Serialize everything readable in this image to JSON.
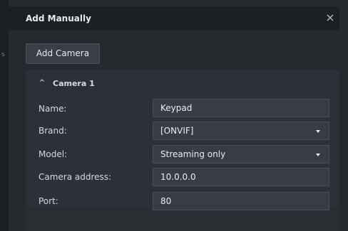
{
  "dialog": {
    "title": "Add Manually",
    "close_symbol": "×"
  },
  "toolbar": {
    "add_camera_label": "Add Camera"
  },
  "camera": {
    "section_label": "Camera 1",
    "toggle_icon": "chevron-up-icon",
    "toggle_symbol": "^",
    "fields": {
      "name": {
        "label": "Name:",
        "value": "Keypad"
      },
      "brand": {
        "label": "Brand:",
        "value": "[ONVIF]"
      },
      "model": {
        "label": "Model:",
        "value": "Streaming only"
      },
      "camera_address": {
        "label": "Camera address:",
        "value": "10.0.0.0"
      },
      "port": {
        "label": "Port:",
        "value": "80"
      }
    }
  },
  "background": {
    "left_edge_mark": "s"
  },
  "colors": {
    "dialog_bg": "#262a2f",
    "header_bg": "#1c1f23",
    "panel_bg": "#2d3137",
    "control_bg": "#383d44",
    "text": "#e7eaee"
  }
}
